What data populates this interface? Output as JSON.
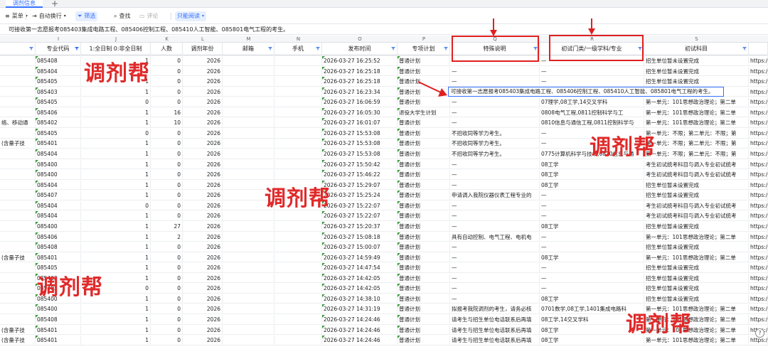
{
  "tabs": {
    "active": "调剂信息",
    "add": "+"
  },
  "toolbar": {
    "menu": "菜单",
    "wrap": "自动换行",
    "filter": "筛选",
    "find": "查找",
    "comment": "评论",
    "reading": "只能阅读"
  },
  "formula_bar": "可接收第一志愿报考085403集成电路工程、085406控制工程、085410人工智能、085801电气工程的考生。",
  "columns": [
    "I",
    "J",
    "K",
    "L",
    "M",
    "N",
    "O",
    "P",
    "Q",
    "R",
    "S"
  ],
  "headers": [
    "专业代码",
    "1:全日制 0:非全日制",
    "人数",
    "调剂年份",
    "邮箱",
    "手机",
    "发布时间",
    "专项计划",
    "特殊说明",
    "初试门类/一级学科/专业",
    "初试科目"
  ],
  "rows": [
    {
      "pre": "",
      "code": "085408",
      "ft": "1",
      "n": "0",
      "y": "2026",
      "t": "2026-03-27 16:25:52",
      "p": "普通计划",
      "q": "—",
      "r": "—",
      "s": "招生单位暂未设置完成",
      "u": "https:/"
    },
    {
      "pre": "",
      "code": "085404",
      "ft": "1",
      "n": "0",
      "y": "2026",
      "t": "2026-03-27 16:25:18",
      "p": "普通计划",
      "q": "—",
      "r": "—",
      "s": "招生单位暂未设置完成",
      "u": "https:/"
    },
    {
      "pre": "",
      "code": "085405",
      "ft": "1",
      "n": "0",
      "y": "2026",
      "t": "2026-03-27 16:25:18",
      "p": "普通计划",
      "q": "—",
      "r": "—",
      "s": "招生单位暂未设置完成",
      "u": "https:/"
    },
    {
      "pre": "",
      "code": "085403",
      "ft": "1",
      "n": "0",
      "y": "2026",
      "t": "2026-03-27 16:23:34",
      "p": "普通计划",
      "q": "可接收第一志愿报考085403集成电路工程、085406控制工程、085410人工智能、085801电气工程的考生。",
      "r": "",
      "s": "",
      "u": "https:/"
    },
    {
      "pre": "",
      "code": "085405",
      "ft": "0",
      "n": "0",
      "y": "2026",
      "t": "2026-03-27 16:06:59",
      "p": "普通计划",
      "q": "—",
      "r": "07理学,08工学,14交叉学科",
      "s": "第一单元：101思想政治理论；第二单",
      "u": "https:/"
    },
    {
      "pre": "",
      "code": "085406",
      "ft": "1",
      "n": "16",
      "y": "2026",
      "t": "2026-03-27 16:05:30",
      "p": "退役大学生计划",
      "q": "—",
      "r": "0808电气工程,0811控制科学与工",
      "s": "第一单元：101思想政治理论；第二单",
      "u": "https:/"
    },
    {
      "pre": "络、移动通",
      "code": "085402",
      "ft": "1",
      "n": "10",
      "y": "2026",
      "t": "2026-03-27 16:01:07",
      "p": "普通计划",
      "q": "—",
      "r": "0810信息与通信工程,0811控制科学与",
      "s": "第一单元：101思想政治理论；第二单",
      "u": "https:/"
    },
    {
      "pre": "",
      "code": "085405",
      "ft": "0",
      "n": "0",
      "y": "2026",
      "t": "2026-03-27 15:53:08",
      "p": "普通计划",
      "q": "不招收同等学力考生。",
      "r": "—",
      "s": "第一单元：不限；第二单元：不限；第",
      "u": "https:/"
    },
    {
      "pre": "(含量子技",
      "code": "085401",
      "ft": "1",
      "n": "0",
      "y": "2026",
      "t": "2026-03-27 15:53:08",
      "p": "普通计划",
      "q": "不招收同等学力考生。",
      "r": "—",
      "s": "第一单元：不限；第二单元：不限；第",
      "u": "https:/"
    },
    {
      "pre": "",
      "code": "085404",
      "ft": "1",
      "n": "0",
      "y": "2026",
      "t": "2026-03-27 15:53:08",
      "p": "普通计划",
      "q": "不招收同等学力考生。",
      "r": "0775计算机科学与技术,0810信息与通",
      "s": "第一单元：不限；第二单元：不限；第",
      "u": "https:/"
    },
    {
      "pre": "",
      "code": "085400",
      "ft": "1",
      "n": "0",
      "y": "2026",
      "t": "2026-03-27 15:50:42",
      "p": "普通计划",
      "q": "—",
      "r": "08工学",
      "s": "考生初试统考科目与调入专业初试统考",
      "u": "https:/"
    },
    {
      "pre": "",
      "code": "085400",
      "ft": "1",
      "n": "0",
      "y": "2026",
      "t": "2026-03-27 15:46:22",
      "p": "普通计划",
      "q": "—",
      "r": "08工学",
      "s": "考生初试统考科目与调入专业初试统考",
      "u": "https:/"
    },
    {
      "pre": "",
      "code": "085404",
      "ft": "1",
      "n": "0",
      "y": "2026",
      "t": "2026-03-27 15:29:07",
      "p": "普通计划",
      "q": "—",
      "r": "08工学",
      "s": "招生单位暂未设置完成",
      "u": "https:/"
    },
    {
      "pre": "",
      "code": "085407",
      "ft": "1",
      "n": "0",
      "y": "2026",
      "t": "2026-03-27 15:25:24",
      "p": "普通计划",
      "q": "申请调入我院仪器仪表工程专业的",
      "r": "—",
      "s": "招生单位暂未设置完成",
      "u": "https:/"
    },
    {
      "pre": "",
      "code": "085404",
      "ft": "0",
      "n": "0",
      "y": "2026",
      "t": "2026-03-27 15:22:07",
      "p": "普通计划",
      "q": "—",
      "r": "—",
      "s": "考生初试统考科目与调入专业初试统考",
      "u": "https:/"
    },
    {
      "pre": "",
      "code": "085404",
      "ft": "1",
      "n": "0",
      "y": "2026",
      "t": "2026-03-27 15:22:07",
      "p": "普通计划",
      "q": "—",
      "r": "—",
      "s": "考生初试统考科目与调入专业初试统考",
      "u": "https:/"
    },
    {
      "pre": "",
      "code": "085400",
      "ft": "1",
      "n": "27",
      "y": "2026",
      "t": "2026-03-27 15:20:37",
      "p": "普通计划",
      "q": "—",
      "r": "08工学",
      "s": "招生单位暂未设置完成",
      "u": "https:/"
    },
    {
      "pre": "",
      "code": "085406",
      "ft": "1",
      "n": "2",
      "y": "2026",
      "t": "2026-03-27 15:08:18",
      "p": "普通计划",
      "q": "具有自动控制、电气工程、电机电",
      "r": "—",
      "s": "第一单元：101思想政治理论；第二单",
      "u": "https:/"
    },
    {
      "pre": "",
      "code": "085408",
      "ft": "1",
      "n": "0",
      "y": "2026",
      "t": "2026-03-27 15:00:07",
      "p": "普通计划",
      "q": "—",
      "r": "—",
      "s": "招生单位暂未设置完成",
      "u": "https:/"
    },
    {
      "pre": "(含量子技",
      "code": "085401",
      "ft": "1",
      "n": "0",
      "y": "2026",
      "t": "2026-03-27 14:59:49",
      "p": "普通计划",
      "q": "—",
      "r": "08工学",
      "s": "第一单元：101思想政治理论；第二单",
      "u": "https:/"
    },
    {
      "pre": "",
      "code": "085405",
      "ft": "1",
      "n": "0",
      "y": "2026",
      "t": "2026-03-27 14:47:54",
      "p": "普通计划",
      "q": "—",
      "r": "—",
      "s": "招生单位暂未设置完成",
      "u": "https:/"
    },
    {
      "pre": "",
      "code": "085403",
      "ft": "1",
      "n": "0",
      "y": "2026",
      "t": "2026-03-27 14:42:05",
      "p": "普通计划",
      "q": "—",
      "r": "—",
      "s": "招生单位暂未设置完成",
      "u": "https:/"
    },
    {
      "pre": "",
      "code": "085403",
      "ft": "0",
      "n": "0",
      "y": "2026",
      "t": "2026-03-27 14:42:05",
      "p": "普通计划",
      "q": "—",
      "r": "—",
      "s": "招生单位暂未设置完成",
      "u": "https:/"
    },
    {
      "pre": "",
      "code": "085400",
      "ft": "1",
      "n": "0",
      "y": "2026",
      "t": "2026-03-27 14:38:10",
      "p": "普通计划",
      "q": "—",
      "r": "08工学",
      "s": "招生单位暂未设置完成",
      "u": "https:/"
    },
    {
      "pre": "",
      "code": "085400",
      "ft": "1",
      "n": "0",
      "y": "2026",
      "t": "2026-03-27 14:31:19",
      "p": "普通计划",
      "q": "拟报考我院调剂的考生，请务必核",
      "r": "0701数学,08工学,1401集成电路科",
      "s": "第一单元：101思想政治理论；第二单",
      "u": "https:/"
    },
    {
      "pre": "",
      "code": "085408",
      "ft": "1",
      "n": "0",
      "y": "2026",
      "t": "2026-03-27 14:24:46",
      "p": "普通计划",
      "q": "请考生与招生单位电话联系后再填",
      "r": "08工学,14交叉学科",
      "s": "第一单元：101思想政治理论；第二单",
      "u": "https:/"
    },
    {
      "pre": "(含量子技",
      "code": "085401",
      "ft": "1",
      "n": "0",
      "y": "2026",
      "t": "2026-03-27 14:24:46",
      "p": "普通计划",
      "q": "请考生与招生单位电话联系后再填",
      "r": "08工学",
      "s": "第一单元：101思想政治理论；第二单",
      "u": "https:/"
    },
    {
      "pre": "(含量子技",
      "code": "085401",
      "ft": "1",
      "n": "0",
      "y": "2026",
      "t": "2026-03-27 14:24:46",
      "p": "普通计划",
      "q": "请考生与招生单位电话联系后再填",
      "r": "08工学",
      "s": "第一单元：101思想政治理论；第二单",
      "u": "https:/"
    }
  ],
  "watermark": "调剂帮",
  "annotation_color": "#e02020",
  "accent": "#3370ff"
}
